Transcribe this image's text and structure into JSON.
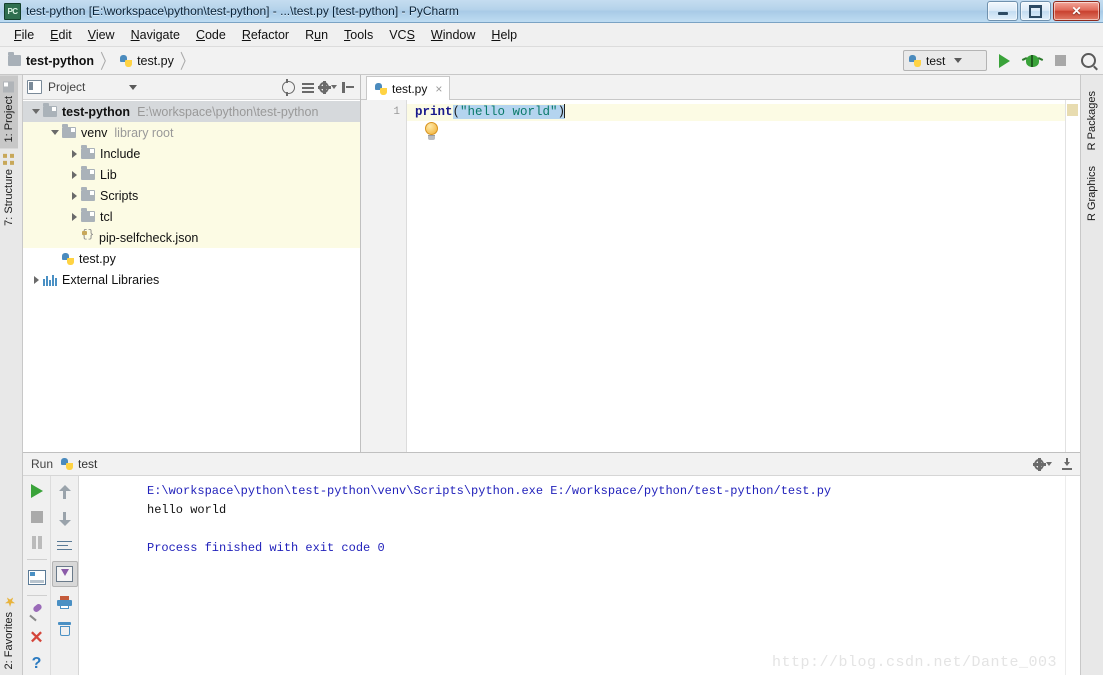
{
  "window": {
    "title": "test-python [E:\\workspace\\python\\test-python] - ...\\test.py [test-python] - PyCharm",
    "app_icon": "pycharm-icon",
    "icon_text": "PC",
    "buttons": {
      "minimize": "–",
      "maximize": "□",
      "close": "✕"
    }
  },
  "menubar": {
    "items": [
      {
        "label": "File",
        "mnemonic": "F"
      },
      {
        "label": "Edit",
        "mnemonic": "E"
      },
      {
        "label": "View",
        "mnemonic": "V"
      },
      {
        "label": "Navigate",
        "mnemonic": "N"
      },
      {
        "label": "Code",
        "mnemonic": "C"
      },
      {
        "label": "Refactor",
        "mnemonic": "R"
      },
      {
        "label": "Run",
        "mnemonic": "R"
      },
      {
        "label": "Tools",
        "mnemonic": "T"
      },
      {
        "label": "VCS",
        "mnemonic": "S"
      },
      {
        "label": "Window",
        "mnemonic": "W"
      },
      {
        "label": "Help",
        "mnemonic": "H"
      }
    ]
  },
  "breadcrumb": {
    "items": [
      {
        "label": "test-python",
        "icon": "folder-icon"
      },
      {
        "label": "test.py",
        "icon": "python-file-icon"
      }
    ],
    "separator": "〉"
  },
  "toolbar": {
    "run_config": {
      "label": "test",
      "icon": "python-icon"
    },
    "run_button": "run-button",
    "debug_button": "debug-button",
    "stop_button": "stop-button",
    "search_button": "search-everywhere-button"
  },
  "left_stripe": {
    "top": [
      {
        "label": "1: Project",
        "selected": true
      },
      {
        "label": "7: Structure",
        "selected": false
      }
    ],
    "bottom": [
      {
        "label": "2: Favorites",
        "selected": false
      }
    ]
  },
  "right_stripe": {
    "items": [
      {
        "label": "R Packages"
      },
      {
        "label": "R Graphics"
      }
    ]
  },
  "project_panel": {
    "title": "Project",
    "tree": [
      {
        "label": "test-python",
        "sub": "E:\\workspace\\python\\test-python",
        "indent": 0,
        "arrow": "down",
        "icon": "folder-icon",
        "bold": true,
        "highlight": "selected"
      },
      {
        "label": "venv",
        "sub": "library root",
        "indent": 1,
        "arrow": "down",
        "icon": "folder-icon",
        "bold": false,
        "highlight": "venv"
      },
      {
        "label": "Include",
        "sub": "",
        "indent": 2,
        "arrow": "right",
        "icon": "folder-icon",
        "bold": false,
        "highlight": "venv"
      },
      {
        "label": "Lib",
        "sub": "",
        "indent": 2,
        "arrow": "right",
        "icon": "folder-icon",
        "bold": false,
        "highlight": "venv"
      },
      {
        "label": "Scripts",
        "sub": "",
        "indent": 2,
        "arrow": "right",
        "icon": "folder-icon",
        "bold": false,
        "highlight": "venv"
      },
      {
        "label": "tcl",
        "sub": "",
        "indent": 2,
        "arrow": "right",
        "icon": "folder-icon",
        "bold": false,
        "highlight": "venv"
      },
      {
        "label": "pip-selfcheck.json",
        "sub": "",
        "indent": 2,
        "arrow": "blank",
        "icon": "json-file-icon",
        "bold": false,
        "highlight": "venv"
      },
      {
        "label": "test.py",
        "sub": "",
        "indent": 1,
        "arrow": "blank",
        "icon": "python-file-icon",
        "bold": false,
        "highlight": "none"
      },
      {
        "label": "External Libraries",
        "sub": "",
        "indent": 0,
        "arrow": "right",
        "icon": "libraries-icon",
        "bold": false,
        "highlight": "none"
      }
    ]
  },
  "editor": {
    "tab": {
      "label": "test.py",
      "icon": "python-file-icon",
      "close": "×"
    },
    "line_numbers": [
      "1"
    ],
    "code": {
      "keyword": "print",
      "open_paren": "(",
      "string": "\"hello world\"",
      "close_paren": ")",
      "selected_text": "(\"hello world\")"
    },
    "intention_bulb": "lightbulb-icon"
  },
  "run_tool": {
    "header_label": "Run",
    "tab_label": "test",
    "console": [
      {
        "text": "E:\\workspace\\python\\test-python\\venv\\Scripts\\python.exe E:/workspace/python/test-python/test.py",
        "color": "blue"
      },
      {
        "text": "hello world",
        "color": "black"
      },
      {
        "text": "",
        "color": "black"
      },
      {
        "text": "Process finished with exit code 0",
        "color": "blue"
      }
    ],
    "left_toolbar": [
      {
        "name": "rerun-button"
      },
      {
        "name": "stop-button"
      },
      {
        "name": "pause-button"
      },
      {
        "name": "toggle-console-button"
      },
      {
        "name": "pin-tab-button"
      },
      {
        "name": "close-button"
      },
      {
        "name": "help-button"
      }
    ],
    "right_toolbar": [
      {
        "name": "previous-occurrence-button"
      },
      {
        "name": "next-occurrence-button"
      },
      {
        "name": "soft-wrap-button"
      },
      {
        "name": "scroll-to-end-button"
      },
      {
        "name": "print-button"
      },
      {
        "name": "clear-all-button"
      }
    ]
  },
  "watermark": "http://blog.csdn.net/Dante_003",
  "colors": {
    "titlebar": "#b4d2ea",
    "accent_green": "#3aa33a",
    "selection": "#b4d4ef",
    "venv_highlight": "#fcfbe4",
    "string_token": "#0a7a6a",
    "keyword_token": "#1a1a8c",
    "console_blue": "#2222bb"
  }
}
